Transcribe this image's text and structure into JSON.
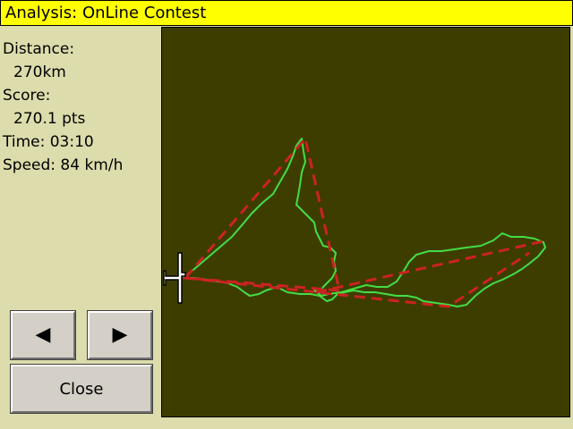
{
  "window": {
    "title": "Analysis: OnLine Contest"
  },
  "info": {
    "distance_label": "Distance:",
    "distance_value": "270km",
    "score_label": "Score:",
    "score_value": "270.1 pts",
    "time_text": "Time: 03:10",
    "speed_text": "Speed: 84 km/h"
  },
  "buttons": {
    "prev_icon": "left-triangle-icon",
    "prev_glyph": "◀",
    "next_icon": "right-triangle-icon",
    "next_glyph": "▶",
    "close_label": "Close"
  },
  "colors": {
    "titlebar_bg": "#ffff00",
    "panel_bg": "#dcdcac",
    "map_bg": "#3d3d00",
    "track": "#44dd44",
    "contest_triangle": "#cc2222",
    "glider": "#ffffff"
  },
  "map": {
    "icons": [
      "glider-icon"
    ]
  }
}
